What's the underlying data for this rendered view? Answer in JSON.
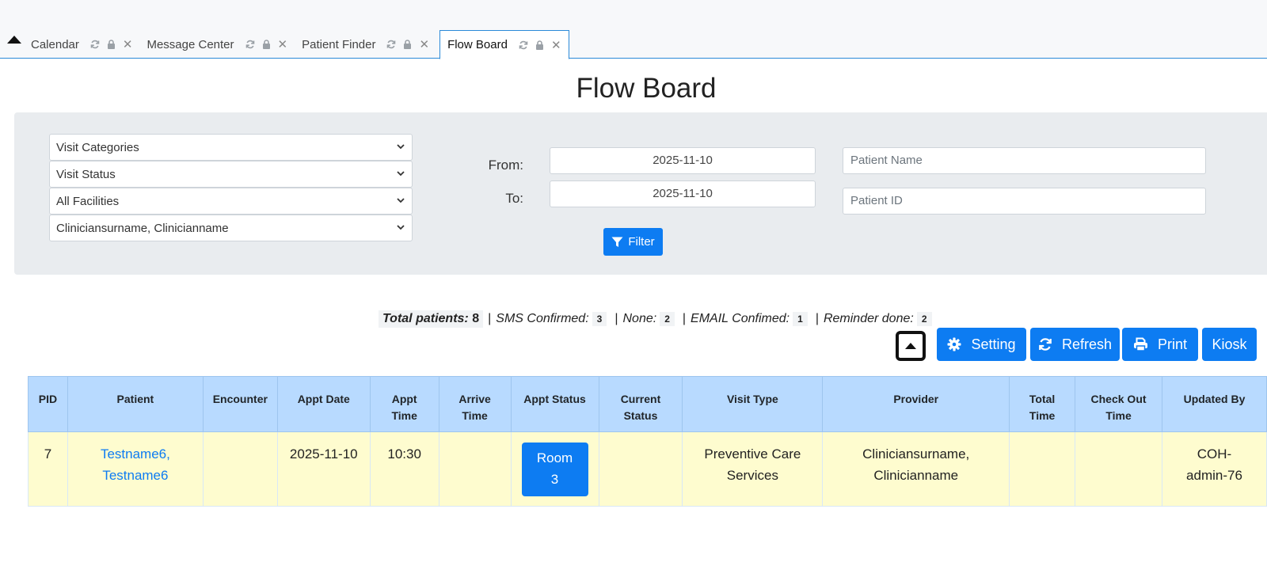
{
  "tabs": [
    {
      "label": "Calendar"
    },
    {
      "label": "Message Center"
    },
    {
      "label": "Patient Finder"
    },
    {
      "label": "Flow Board",
      "active": true
    }
  ],
  "page_title": "Flow Board",
  "filters": {
    "visit_categories": "Visit Categories",
    "visit_status": "Visit Status",
    "facilities": "All Facilities",
    "provider": "Cliniciansurname, Clinicianname",
    "from_label": "From:",
    "to_label": "To:",
    "from_date": "2025-11-10",
    "to_date": "2025-11-10",
    "patient_name_placeholder": "Patient Name",
    "patient_id_placeholder": "Patient ID",
    "filter_button": "Filter"
  },
  "summary": {
    "total_label": "Total patients:",
    "total_value": "8",
    "sms_label": "SMS Confirmed:",
    "sms_value": "3",
    "none_label": "None:",
    "none_value": "2",
    "email_label": "EMAIL Confimed:",
    "email_value": "1",
    "reminder_label": "Reminder done:",
    "reminder_value": "2"
  },
  "actions": {
    "setting": "Setting",
    "refresh": "Refresh",
    "print": "Print",
    "kiosk": "Kiosk"
  },
  "table": {
    "headers": {
      "pid": "PID",
      "patient": "Patient",
      "encounter": "Encounter",
      "appt_date": "Appt Date",
      "appt_time_1": "Appt",
      "appt_time_2": "Time",
      "arrive_time_1": "Arrive",
      "arrive_time_2": "Time",
      "appt_status": "Appt Status",
      "current_status_1": "Current",
      "current_status_2": "Status",
      "visit_type": "Visit Type",
      "provider": "Provider",
      "total_time_1": "Total",
      "total_time_2": "Time",
      "check_out_1": "Check Out",
      "check_out_2": "Time",
      "updated_by": "Updated By"
    },
    "rows": [
      {
        "pid": "7",
        "patient_1": "Testname6,",
        "patient_2": "Testname6",
        "encounter": "",
        "appt_date": "2025-11-10",
        "appt_time": "10:30",
        "arrive_time": "",
        "appt_status_1": "Room",
        "appt_status_2": "3",
        "current_status": "",
        "visit_type_1": "Preventive Care",
        "visit_type_2": "Services",
        "provider_1": "Cliniciansurname,",
        "provider_2": "Clinicianname",
        "total_time": "",
        "check_out_time": "",
        "updated_by_1": "COH-",
        "updated_by_2": "admin-76"
      }
    ]
  },
  "colors": {
    "primary": "#0d7cf2",
    "header_bg": "#b8daff",
    "row_bg": "#fefccf",
    "panel_bg": "#e9ecef"
  }
}
